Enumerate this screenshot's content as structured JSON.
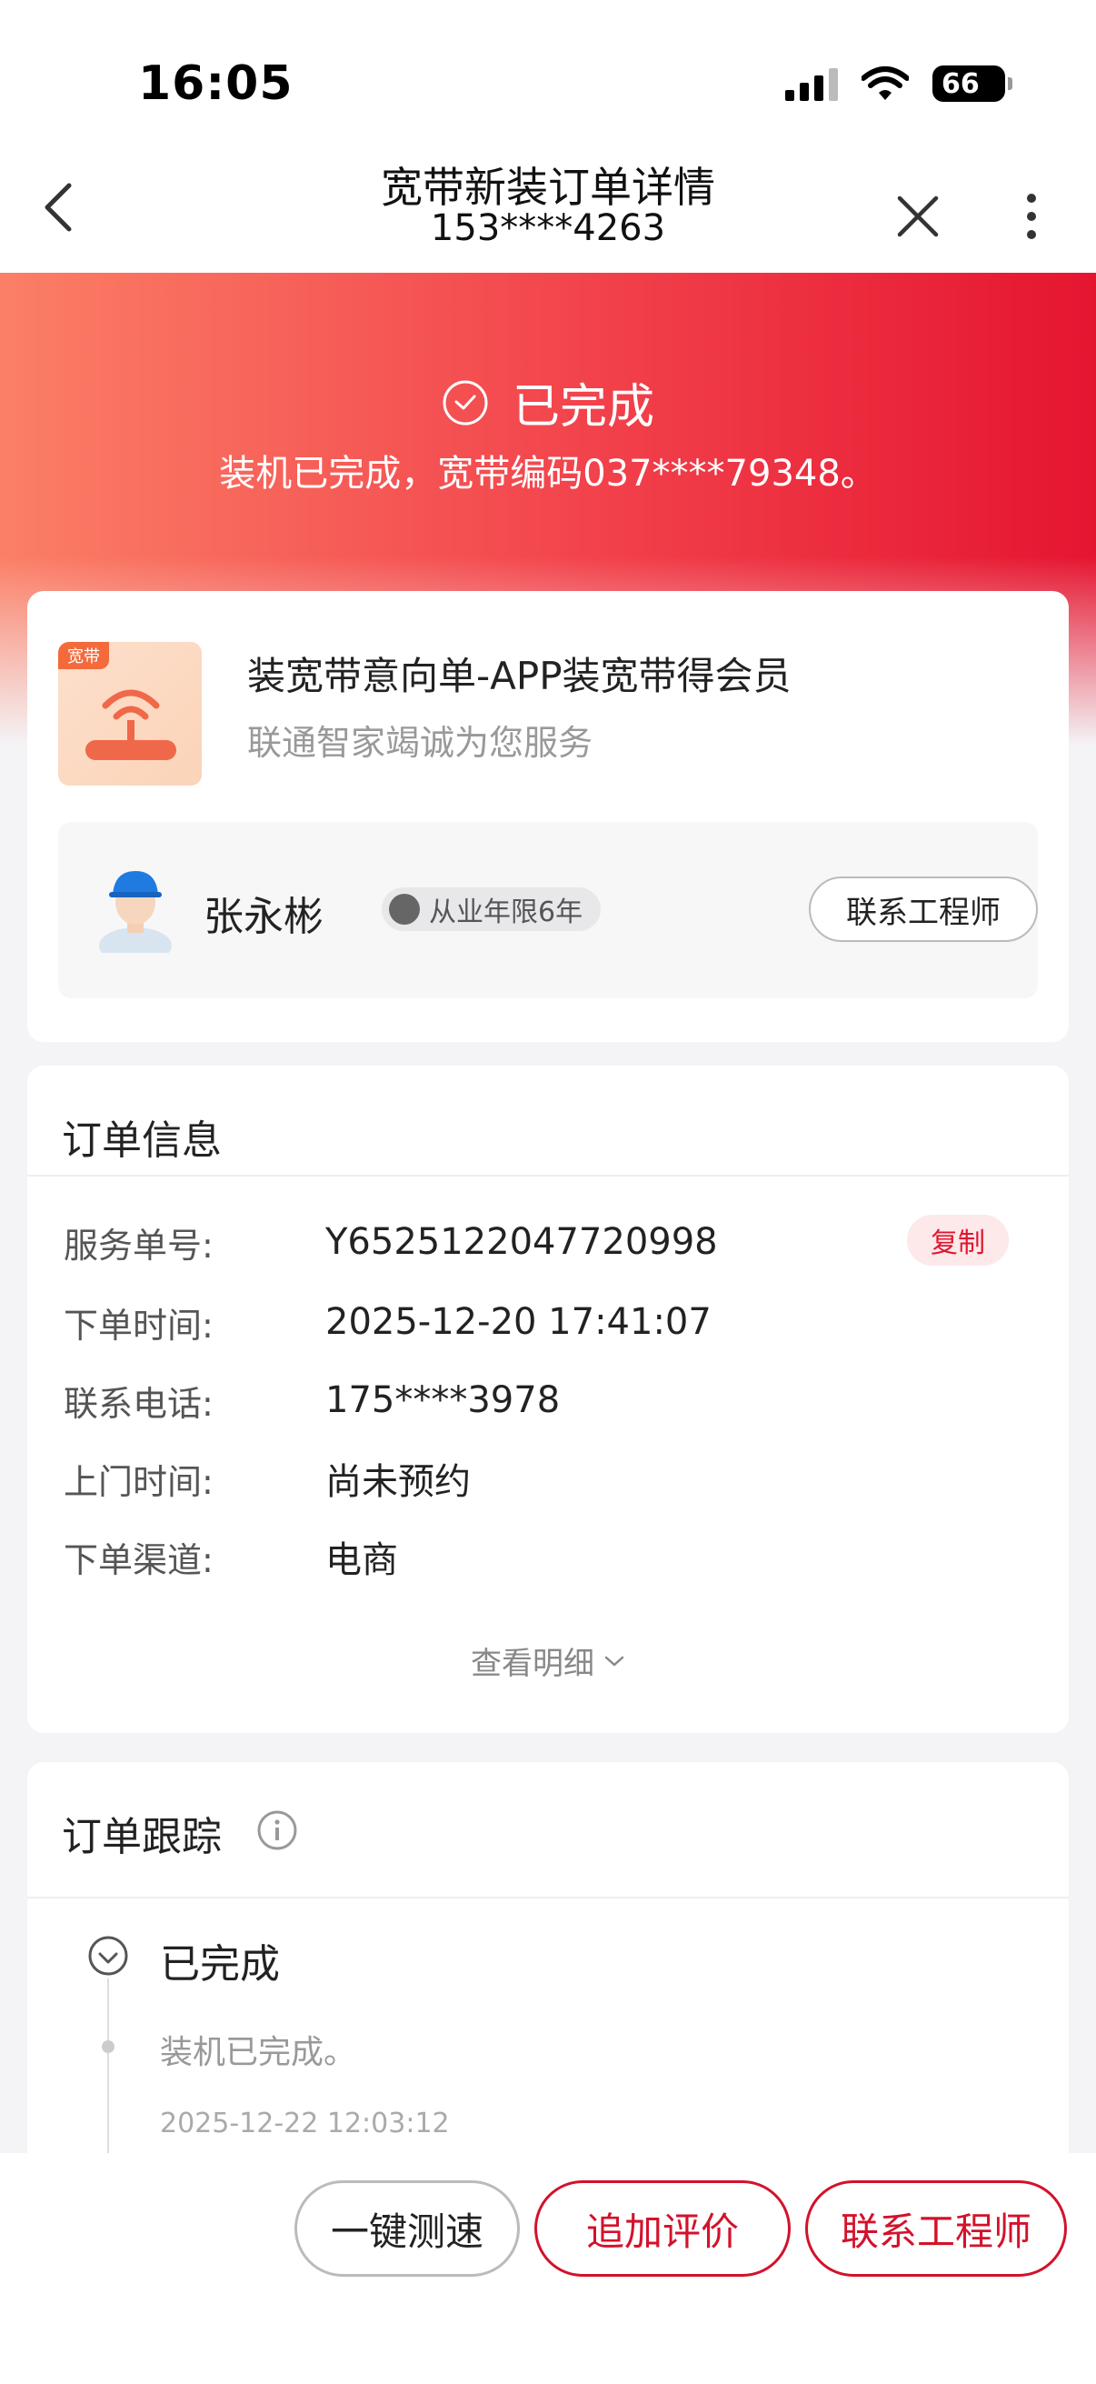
{
  "status_bar": {
    "time": "16:05",
    "battery": "66"
  },
  "nav": {
    "title": "宽带新装订单详情",
    "subtitle": "153****4263"
  },
  "hero": {
    "status": "已完成",
    "description": "装机已完成，宽带编码037****79348。"
  },
  "product": {
    "tag": "宽带",
    "title": "装宽带意向单-APP装宽带得会员",
    "subtitle": "联通智家竭诚为您服务"
  },
  "engineer": {
    "name": "张永彬",
    "badge": "从业年限6年",
    "contact_label": "联系工程师"
  },
  "order_info": {
    "title": "订单信息",
    "copy_label": "复制",
    "detail_label": "查看明细",
    "rows": [
      {
        "label": "服务单号:",
        "value": "Y652512204772099​8"
      },
      {
        "label": "下单时间:",
        "value": "2025-12-20 17:41:07"
      },
      {
        "label": "联系电话:",
        "value": "175****3978"
      },
      {
        "label": "上门时间:",
        "value": "尚未预约"
      },
      {
        "label": "下单渠道:",
        "value": "电商"
      }
    ]
  },
  "tracking": {
    "title": "订单跟踪",
    "items": [
      {
        "status": "已完成",
        "desc": "装机已完成。",
        "time": "2025-12-22 12:03:12"
      }
    ]
  },
  "bottom_bar": {
    "speed_test": "一键测速",
    "add_review": "追加评价",
    "contact_engineer": "联系工程师"
  },
  "colors": {
    "brand_red": "#e51530",
    "accent_red": "#d3122b"
  }
}
